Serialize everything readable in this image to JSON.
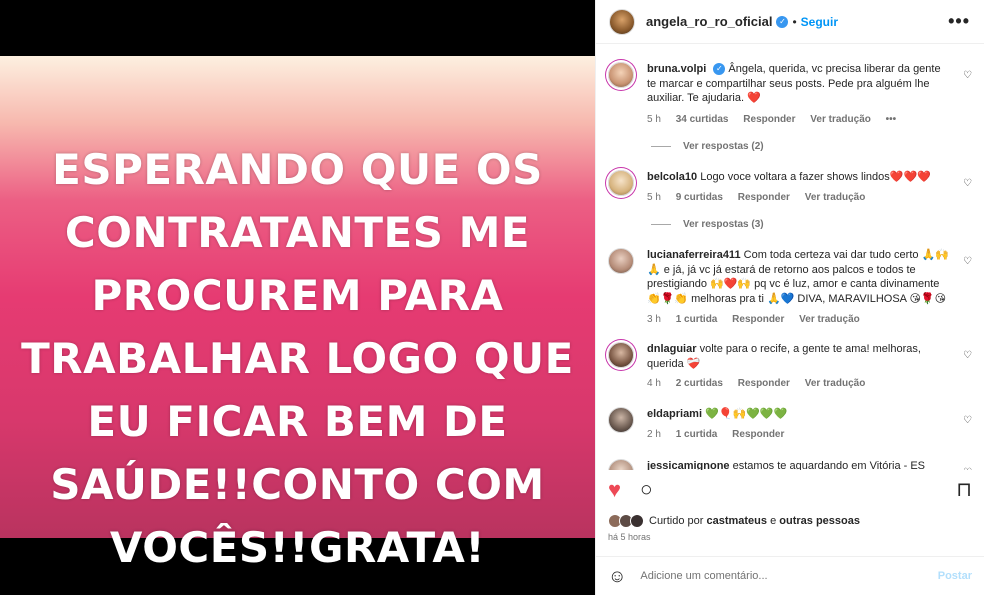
{
  "post": {
    "image_text": [
      "ESPERANDO QUE OS",
      "CONTRATANTES ME",
      "PROCUREM PARA",
      "TRABALHAR LOGO QUE",
      "EU FICAR BEM DE",
      "SAÚDE!!CONTO COM",
      "VOCÊS!!GRATA!"
    ]
  },
  "header": {
    "username": "angela_ro_ro_oficial",
    "verified_icon": "✓",
    "separator": "•",
    "follow_label": "Seguir",
    "more_icon": "•••"
  },
  "comments": [
    {
      "username": "bruna.volpi",
      "verified": true,
      "text": "Ângela, querida, vc precisa liberar da gente te marcar e compartilhar seus posts. Pede pra alguém lhe auxiliar. Te ajudaria. ❤️",
      "time": "5 h",
      "likes": "34 curtidas",
      "reply": "Responder",
      "translate": "Ver tradução",
      "options": "•••",
      "replies_label": "Ver respostas (2)"
    },
    {
      "username": "belcola10",
      "verified": false,
      "text": "Logo voce voltara a fazer shows lindos❤️❤️❤️",
      "time": "5 h",
      "likes": "9 curtidas",
      "reply": "Responder",
      "translate": "Ver tradução",
      "replies_label": "Ver respostas (3)"
    },
    {
      "username": "lucianaferreira411",
      "verified": false,
      "text": "Com toda certeza vai dar tudo certo 🙏🙌🙏 e já, já vc já estará de retorno aos palcos e todos te prestigiando 🙌❤️🙌 pq vc é luz, amor e canta divinamente 👏🌹👏 melhoras pra ti 🙏💙 DIVA, MARAVILHOSA 😘🌹😘",
      "time": "3 h",
      "likes": "1 curtida",
      "reply": "Responder",
      "translate": "Ver tradução"
    },
    {
      "username": "dnlaguiar",
      "verified": false,
      "text": "volte para o recife, a gente te ama! melhoras, querida ❤️‍🩹",
      "time": "4 h",
      "likes": "2 curtidas",
      "reply": "Responder",
      "translate": "Ver tradução"
    },
    {
      "username": "eldapriami",
      "verified": false,
      "text": "💚🎈🙌💚💚💚",
      "time": "2 h",
      "likes": "1 curtida",
      "reply": "Responder"
    },
    {
      "username": "jessicamignone",
      "verified": false,
      "text": "estamos te aguardando em Vitória - ES"
    }
  ],
  "actions": {
    "like_icon": "♥",
    "comment_icon": "○",
    "save_icon": "⊓",
    "like_color": "#ed4956"
  },
  "likes": {
    "prefix": "Curtido por",
    "user": "castmateus",
    "and": "e",
    "others": "outras pessoas"
  },
  "time_ago": "há 5 horas",
  "add_comment": {
    "emoji_icon": "☺",
    "placeholder": "Adicione um comentário...",
    "post_label": "Postar"
  },
  "comment_heart_icon": "♡"
}
